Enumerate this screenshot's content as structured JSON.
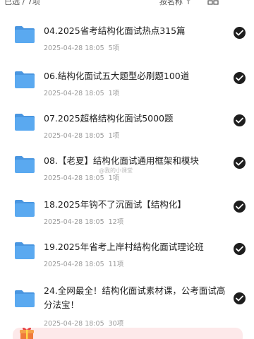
{
  "topbar": {
    "selected_text": "已选 / 7项",
    "sort_label": "按名称 ↑",
    "layout_icon": "grid-view-icon"
  },
  "files": [
    {
      "name": "04.2025省考结构化面试热点315篇",
      "date": "2025-04-28 18:05",
      "count": "5项",
      "selected": true
    },
    {
      "name": "06.结构化面试五大题型必刷题100道",
      "date": "2025-04-28 18:05",
      "count": "1项",
      "selected": true
    },
    {
      "name": "07.2025超格结构化面试5000题",
      "date": "2025-04-28 18:05",
      "count": "1项",
      "selected": true
    },
    {
      "name": "08.【老夏】结构化面试通用框架和模块",
      "date": "2025-04-28 18:05",
      "count": "1项",
      "selected": true
    },
    {
      "name": "18.2025年钩不了沉面试【结构化】",
      "date": "2025-04-28 18:05",
      "count": "12项",
      "selected": true
    },
    {
      "name": "19.2025年省考上岸村结构化面试理论班",
      "date": "2025-04-28 18:05",
      "count": "11项",
      "selected": true
    },
    {
      "name": "24.全网最全！结构化面试素材课，公考面试高分法宝！",
      "date": "2025-04-28 18:05",
      "count": "30项",
      "selected": true
    }
  ],
  "watermark": "@我的小课堂",
  "banner": {
    "icon": "gift-icon",
    "text": ""
  },
  "colors": {
    "folder": "#5aa9f0",
    "folder_tab": "#4a96e0",
    "check": "#1e1e1e",
    "banner_bg": "#fde9ea"
  }
}
